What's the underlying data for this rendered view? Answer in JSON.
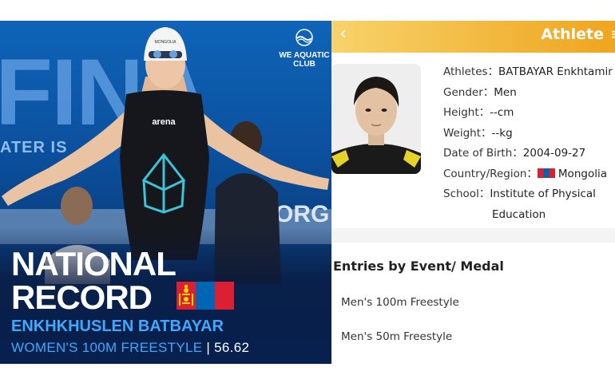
{
  "poster": {
    "bg_word": "FINA",
    "bg_tagline": "ATER IS",
    "bg_tagline_right": "ORG",
    "cap_text": "MONGOLIA",
    "suit_brand": "arena",
    "club": {
      "line1": "WE AQUATIC",
      "line2": "CLUB"
    },
    "headline_1": "NATIONAL",
    "headline_2": "RECORD",
    "athlete_name": "ENKHKHUSLEN BATBAYAR",
    "event": "WOMEN'S 100M FREESTYLE",
    "separator": " | ",
    "time": "56.62",
    "colors": {
      "bg": "#0b4f9c",
      "name_blue": "#3ea9ff",
      "flag_red": "#da2032",
      "flag_blue": "#0066b3",
      "flag_gold": "#ffd900"
    }
  },
  "panel": {
    "back_icon": "chevron-left-icon",
    "title": "Athlete",
    "accent": "#f2b73c",
    "info": {
      "athletes_label": "Athletes：",
      "athletes_value": "BATBAYAR Enkhtamir",
      "gender_label": "Gender：",
      "gender_value": "Men",
      "height_label": "Height：",
      "height_value": "--cm",
      "weight_label": "Weight：",
      "weight_value": "--kg",
      "dob_label": "Date of Birth：",
      "dob_value": "2004-09-27",
      "country_label": "Country/Region：",
      "country_value": "Mongolia",
      "school_label": "School：",
      "school_value_1": "Institute of Physical",
      "school_value_2": "Education"
    },
    "entries": {
      "heading": "Entries by Event/ Medal",
      "items": [
        "Men's 100m Freestyle",
        "Men's 50m Freestyle"
      ]
    }
  }
}
